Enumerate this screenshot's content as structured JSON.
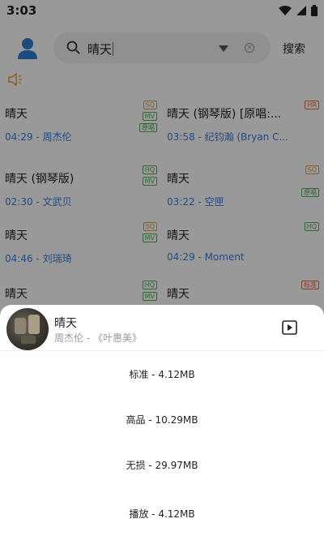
{
  "status": {
    "time": "3:03"
  },
  "search": {
    "value": "晴天",
    "button_label": "搜索"
  },
  "songs": [
    {
      "title": "晴天",
      "time": "04:29",
      "artist": "周杰伦",
      "badges": [
        {
          "text": "SQ",
          "color": "#e0a23a"
        },
        {
          "text": "MV",
          "color": "#4caf50"
        },
        {
          "text": "原唱",
          "color": "#4caf50"
        }
      ]
    },
    {
      "title": "晴天 (钢琴版) [原唱:...",
      "time": "03:58",
      "artist": "纪钧瀚 (Bryan C...",
      "badges": [
        {
          "text": "HR",
          "color": "#e06a4a"
        }
      ]
    },
    {
      "title": "晴天 (钢琴版)",
      "time": "02:30",
      "artist": "文武贝",
      "badges": [
        {
          "text": "HQ",
          "color": "#4caf50"
        },
        {
          "text": "MV",
          "color": "#4caf50"
        }
      ]
    },
    {
      "title": "晴天",
      "time": "03:22",
      "artist": "空匣",
      "badges": [
        {
          "text": "SQ",
          "color": "#e0a23a"
        },
        {
          "text": "原唱",
          "color": "#4caf50"
        }
      ]
    },
    {
      "title": "晴天",
      "time": "04:46",
      "artist": "刘瑞琦",
      "badges": [
        {
          "text": "SQ",
          "color": "#e0a23a"
        },
        {
          "text": "MV",
          "color": "#4caf50"
        }
      ]
    },
    {
      "title": "晴天",
      "time": "04:29",
      "artist": "Moment",
      "badges": [
        {
          "text": "HQ",
          "color": "#4caf50"
        }
      ]
    },
    {
      "title": "晴天",
      "time": "",
      "artist": "",
      "badges": [
        {
          "text": "HQ",
          "color": "#4caf50"
        },
        {
          "text": "MV",
          "color": "#4caf50"
        }
      ]
    },
    {
      "title": "晴天",
      "time": "",
      "artist": "",
      "badges": [
        {
          "text": "标准",
          "color": "#e06a4a"
        }
      ]
    }
  ],
  "sheet": {
    "title": "晴天",
    "subtitle": "周杰伦 - 《叶惠美》",
    "options": [
      "标准 - 4.12MB",
      "高品 - 10.29MB",
      "无损 - 29.97MB",
      "播放 - 4.12MB"
    ]
  },
  "colors": {
    "accent": "#3a7ed8",
    "avatar": "#2d7fd3",
    "volume": "#e0a23a"
  },
  "icons": [
    "avatar-icon",
    "search-icon",
    "dropdown-icon",
    "clear-icon",
    "volume-icon",
    "mv-play-icon",
    "wifi-icon",
    "signal-icon",
    "battery-icon"
  ]
}
